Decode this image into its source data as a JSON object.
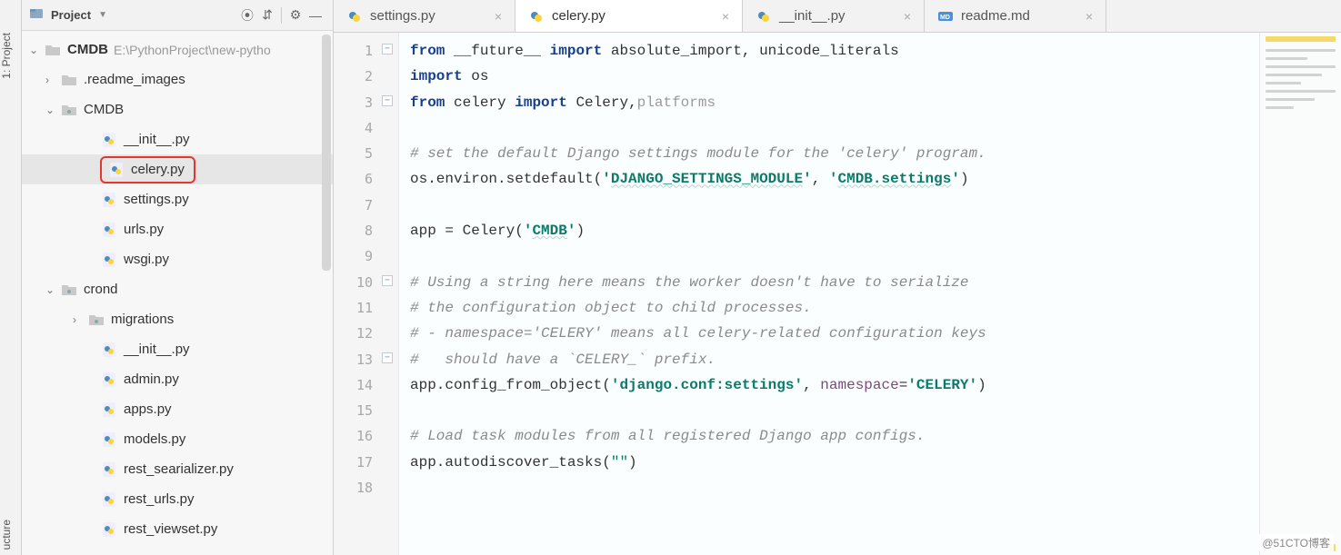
{
  "rail": {
    "project": "1: Project",
    "structure": "ucture"
  },
  "panel": {
    "title": "Project"
  },
  "tree": {
    "root": {
      "name": "CMDB",
      "path": "E:\\PythonProject\\new-pytho"
    },
    "readme_images": ".readme_images",
    "cmdb_folder": "CMDB",
    "cmdb_children": {
      "init": "__init__.py",
      "celery": "celery.py",
      "settings": "settings.py",
      "urls": "urls.py",
      "wsgi": "wsgi.py"
    },
    "crond_folder": "crond",
    "migrations": "migrations",
    "crond_children": {
      "init": "__init__.py",
      "admin": "admin.py",
      "apps": "apps.py",
      "models": "models.py",
      "rest_serializer": "rest_searializer.py",
      "rest_urls": "rest_urls.py",
      "rest_viewset": "rest_viewset.py"
    }
  },
  "tabs": [
    {
      "file": "settings.py",
      "type": "py",
      "active": false
    },
    {
      "file": "celery.py",
      "type": "py",
      "active": true
    },
    {
      "file": "__init__.py",
      "type": "py",
      "active": false
    },
    {
      "file": "readme.md",
      "type": "md",
      "active": false
    }
  ],
  "code": {
    "l1a": "from ",
    "l1b": "__future__",
    "l1c": " import ",
    "l1d": "absolute_import, unicode_literals",
    "l2a": "import ",
    "l2b": "os",
    "l3a": "from ",
    "l3b": "celery ",
    "l3c": "import ",
    "l3d": "Celery,",
    "l3e": "platforms",
    "l5": "# set the default Django settings module for the 'celery' program.",
    "l6a": "os.environ.setdefault(",
    "l6b": "'",
    "l6c": "DJANGO_SETTINGS_MODULE",
    "l6d": "'",
    "l6e": ", ",
    "l6f": "'",
    "l6g": "CMDB.settings",
    "l6h": "'",
    "l6i": ")",
    "l8a": "app = Celery(",
    "l8b": "'",
    "l8c": "CMDB",
    "l8d": "'",
    "l8e": ")",
    "l10": "# Using a string here means the worker doesn't have to serialize",
    "l11": "# the configuration object to child processes.",
    "l12": "# - namespace='CELERY' means all celery-related configuration keys",
    "l13": "#   should have a `CELERY_` prefix.",
    "l14a": "app.config_from_object(",
    "l14b": "'django.conf:settings'",
    "l14c": ", ",
    "l14d": "namespace",
    "l14e": "=",
    "l14f": "'CELERY'",
    "l14g": ")",
    "l16": "# Load task modules from all registered Django app configs.",
    "l17a": "app.autodiscover_tasks(",
    "l17b": "\"\"",
    "l17c": ")"
  },
  "lines": [
    "1",
    "2",
    "3",
    "4",
    "5",
    "6",
    "7",
    "8",
    "9",
    "10",
    "11",
    "12",
    "13",
    "14",
    "15",
    "16",
    "17",
    "18"
  ],
  "watermark": "@51CTO博客"
}
